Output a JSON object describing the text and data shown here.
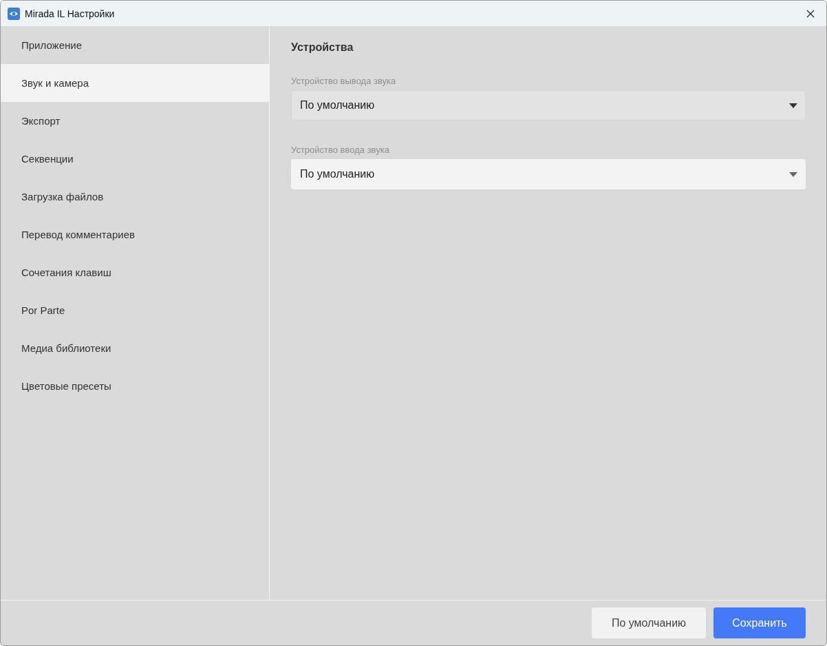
{
  "window": {
    "title": "Mirada IL Настройки"
  },
  "sidebar": {
    "items": [
      {
        "label": "Приложение",
        "selected": false
      },
      {
        "label": "Звук и камера",
        "selected": true
      },
      {
        "label": "Экспорт",
        "selected": false
      },
      {
        "label": "Секвенции",
        "selected": false
      },
      {
        "label": "Загрузка файлов",
        "selected": false
      },
      {
        "label": "Перевод комментариев",
        "selected": false
      },
      {
        "label": "Сочетания клавиш",
        "selected": false
      },
      {
        "label": "Por Parte",
        "selected": false
      },
      {
        "label": "Медиа библиотеки",
        "selected": false
      },
      {
        "label": "Цветовые пресеты",
        "selected": false
      }
    ]
  },
  "section": {
    "title": "Устройства",
    "fields": [
      {
        "label": "Устройство вывода звука",
        "value": "По умолчанию",
        "hovered": true
      },
      {
        "label": "Устройство ввода звука",
        "value": "По умолчанию",
        "hovered": false
      }
    ]
  },
  "buttons": [
    {
      "label": "По умолчанию",
      "kind": "secondary"
    },
    {
      "label": "Сохранить",
      "kind": "primary"
    }
  ]
}
